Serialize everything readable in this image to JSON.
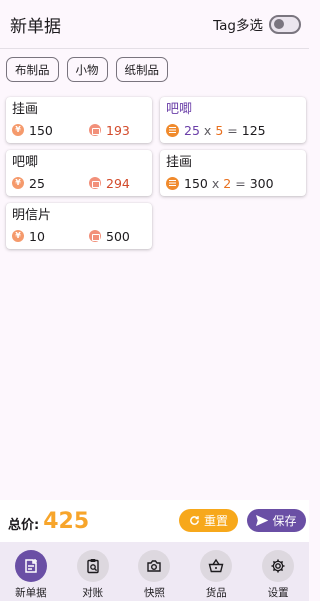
{
  "header": {
    "title": "新单据",
    "tag_label": "Tag多选"
  },
  "chips": [
    "布制品",
    "小物",
    "纸制品"
  ],
  "cards": [
    {
      "name": "挂画",
      "price": "150",
      "qty": "193"
    },
    {
      "name": "吧唧",
      "formula": {
        "a": "25",
        "op": "x",
        "b": "5",
        "eq": "=",
        "result": "125"
      }
    },
    {
      "name": "吧唧",
      "price": "25",
      "qty": "294"
    },
    {
      "name": "挂画",
      "formula": {
        "a": "150",
        "op": "x",
        "b": "2",
        "eq": "=",
        "result": "300"
      }
    },
    {
      "name": "明信片",
      "price": "10",
      "qty": "500"
    }
  ],
  "currency_symbol": "¥",
  "footer": {
    "total_label": "总价:",
    "total_value": "425",
    "reset_label": "重置",
    "save_label": "保存"
  },
  "nav": [
    {
      "label": "新单据",
      "icon": "new-note-icon"
    },
    {
      "label": "对账",
      "icon": "clipboard-search-icon"
    },
    {
      "label": "快照",
      "icon": "camera-icon"
    },
    {
      "label": "货品",
      "icon": "basket-icon"
    },
    {
      "label": "设置",
      "icon": "gear-icon"
    }
  ],
  "colors": {
    "accent": "#6a4fa5",
    "orange": "#f7a81b",
    "total": "#f7a52b"
  }
}
